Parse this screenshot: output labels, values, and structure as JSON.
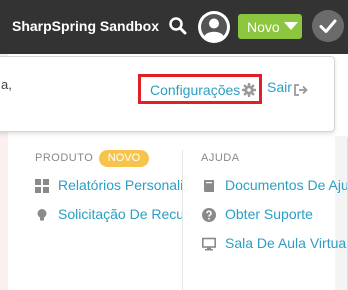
{
  "topbar": {
    "brand": "SharpSpring Sandbox",
    "novo_label": "Novo",
    "icons": {
      "search": "search-icon",
      "avatar": "user-avatar-icon",
      "caret": "caret-down-icon",
      "check": "check-icon"
    },
    "colors": {
      "bar": "#333333",
      "novo": "#8cc63f"
    }
  },
  "header": {
    "truncated_text": "a,",
    "config_label": "Configurações",
    "sair_label": "Sair",
    "highlight_color": "#e02027",
    "link_color": "#2b9fc3"
  },
  "produto": {
    "title": "PRODUTO",
    "badge": "NOVO",
    "items": [
      {
        "label": "Relatórios Personalizados",
        "icon": "dashboard-icon"
      },
      {
        "label": "Solicitação De Recursos",
        "icon": "lightbulb-icon"
      }
    ]
  },
  "ajuda": {
    "title": "AJUDA",
    "items": [
      {
        "label": "Documentos De Ajuda",
        "icon": "book-icon"
      },
      {
        "label": "Obter Suporte",
        "icon": "question-circle-icon"
      },
      {
        "label": "Sala De Aula Virtual",
        "icon": "monitor-icon"
      }
    ]
  }
}
